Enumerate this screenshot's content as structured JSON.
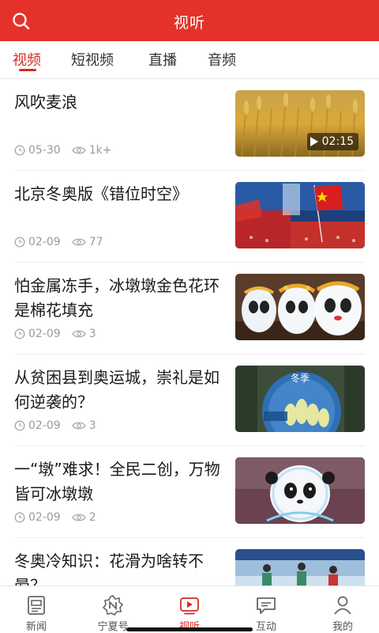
{
  "header": {
    "title": "视听",
    "search_icon": "search-icon"
  },
  "tabs": [
    {
      "label": "视频",
      "active": true
    },
    {
      "label": "短视频",
      "active": false
    },
    {
      "label": "直播",
      "active": false
    },
    {
      "label": "音频",
      "active": false
    }
  ],
  "articles": [
    {
      "title": "风吹麦浪",
      "date": "05-30",
      "views": "1k+",
      "duration": "02:15"
    },
    {
      "title": "北京冬奥版《错位时空》",
      "date": "02-09",
      "views": "77"
    },
    {
      "title": "怕金属冻手，冰墩墩金色花环是棉花填充",
      "date": "02-09",
      "views": "3"
    },
    {
      "title": "从贫困县到奥运城，崇礼是如何逆袭的？",
      "date": "02-09",
      "views": "3",
      "thumb_text": "冬季"
    },
    {
      "title": "一“墩”难求！全民二创，万物皆可冰墩墩",
      "date": "02-09",
      "views": "2"
    },
    {
      "title": "冬奥冷知识：花滑为啥转不晕？",
      "date": "",
      "views": ""
    }
  ],
  "bottom_nav": [
    {
      "label": "新闻",
      "icon": "newspaper-icon",
      "active": false
    },
    {
      "label": "宁夏号",
      "icon": "badge-n-icon",
      "active": false
    },
    {
      "label": "视听",
      "icon": "video-play-icon",
      "active": true
    },
    {
      "label": "互动",
      "icon": "chat-bubble-icon",
      "active": false
    },
    {
      "label": "我的",
      "icon": "user-icon",
      "active": false
    }
  ],
  "colors": {
    "brand": "#e4322a",
    "active_text": "#d42a22",
    "meta_text": "#9a9a9a"
  }
}
